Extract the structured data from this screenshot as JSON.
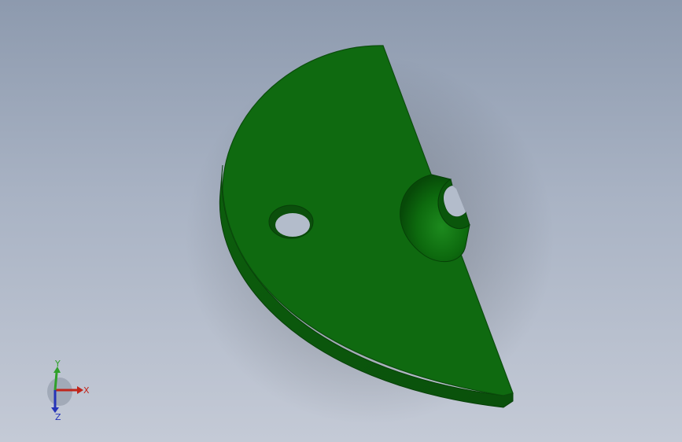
{
  "model": {
    "name": "",
    "part_color": "#0f6a10",
    "edge_color": "#0b4d0c",
    "side_color": "#0a5a0c"
  },
  "background": {
    "top_color": "#8d9aae",
    "bottom_color": "#c4cad6"
  },
  "triad": {
    "x_label": "X",
    "y_label": "Y",
    "z_label": "Z",
    "x_color": "#c0261c",
    "y_color": "#2fa02a",
    "z_color": "#2433b8"
  }
}
